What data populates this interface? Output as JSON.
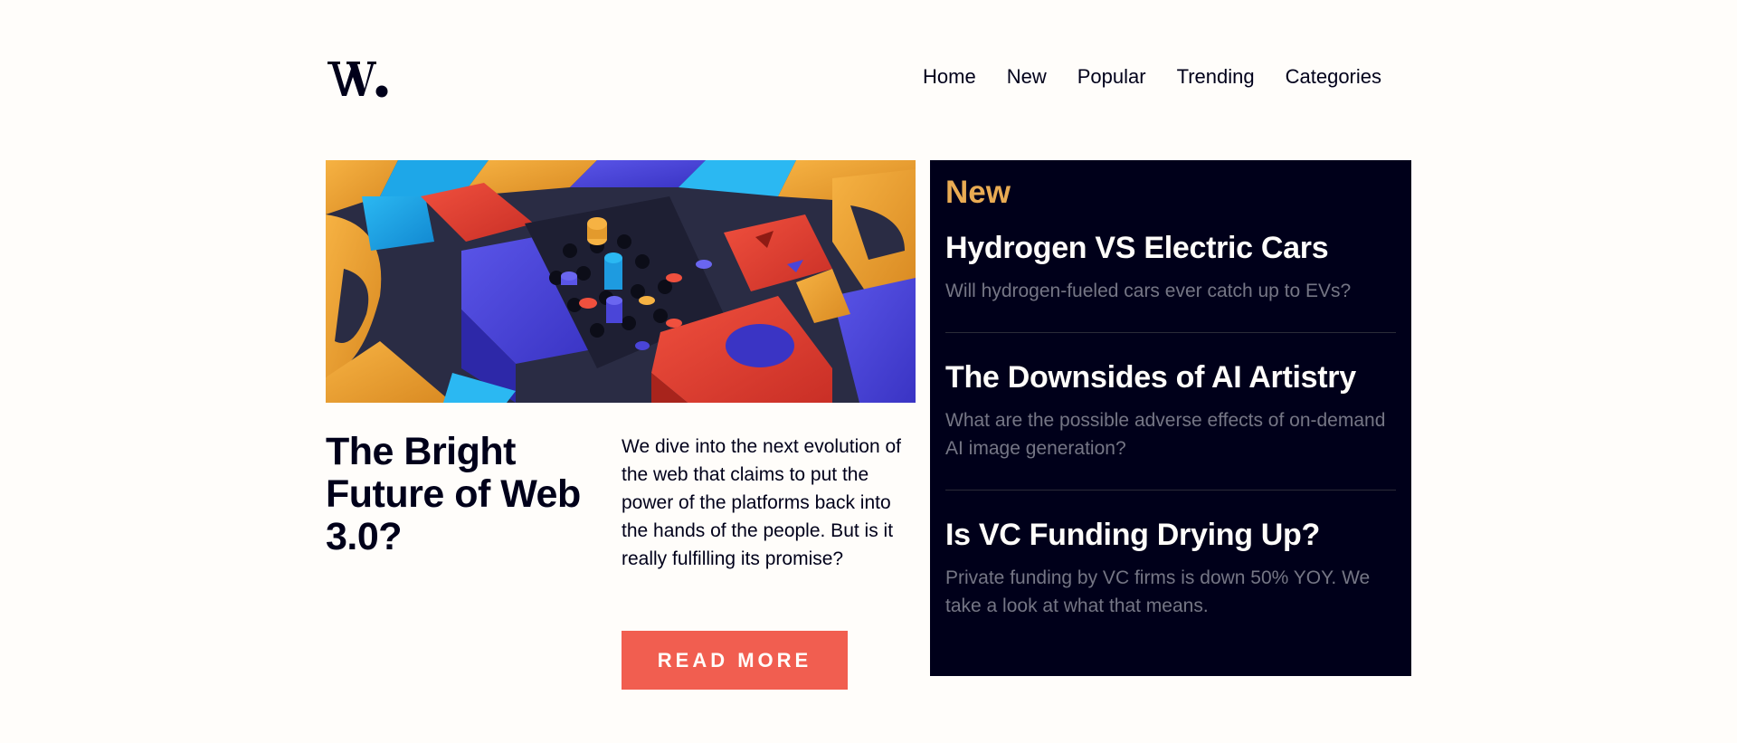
{
  "brand": {
    "logo_text": "W."
  },
  "nav": {
    "items": [
      {
        "label": "Home"
      },
      {
        "label": "New"
      },
      {
        "label": "Popular"
      },
      {
        "label": "Trending"
      },
      {
        "label": "Categories"
      }
    ]
  },
  "hero": {
    "title": "The Bright Future of Web 3.0?",
    "description": "We dive into the next evolution of the web that claims to put the power of the platforms back into the hands of the people. But is it really fulfilling its promise?",
    "button_label": "READ MORE"
  },
  "new_section": {
    "heading": "New",
    "items": [
      {
        "title": "Hydrogen VS Electric Cars",
        "summary": "Will hydrogen-fueled cars ever catch up to EVs?"
      },
      {
        "title": "The Downsides of AI Artistry",
        "summary": "What are the possible adverse effects of on-demand AI image generation?"
      },
      {
        "title": "Is VC Funding Drying Up?",
        "summary": "Private funding by VC firms is down 50% YOY. We take a look at what that means."
      }
    ]
  },
  "colors": {
    "background": "#fffdfa",
    "text_dark": "#00001a",
    "accent_red": "#f15e50",
    "accent_orange": "#e9ab53",
    "muted": "#757685"
  }
}
